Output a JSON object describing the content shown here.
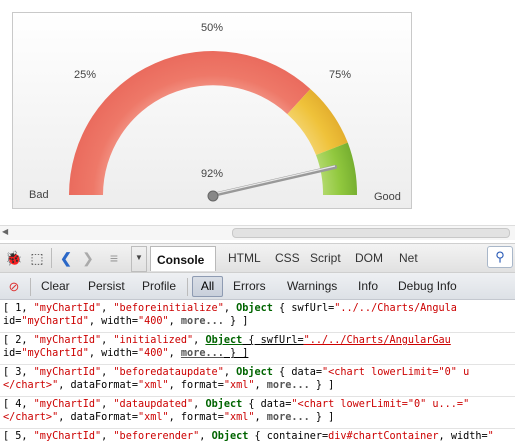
{
  "gauge": {
    "labels": {
      "bad": "Bad",
      "good": "Good",
      "p25": "25%",
      "p50": "50%",
      "p75": "75%",
      "value": "92%"
    },
    "value_percent": 92,
    "colors": {
      "red": "#ef7d6f",
      "yellow": "#f0c640",
      "green": "#8cc63f"
    }
  },
  "toolbar": {
    "console_tab": "Console",
    "panels": [
      "HTML",
      "CSS",
      "Script",
      "DOM",
      "Net"
    ]
  },
  "filterbar": {
    "clear": "Clear",
    "persist": "Persist",
    "profile": "Profile",
    "filters": [
      "All",
      "Errors",
      "Warnings",
      "Info",
      "Debug Info"
    ],
    "selected": "All"
  },
  "log": [
    {
      "l1": [
        "[ 1, ",
        "\"myChartId\"",
        ", ",
        "\"beforeinitialize\"",
        ", ",
        "Object",
        " { ",
        "swfUrl=",
        "\"../../Charts/Angula"
      ],
      "l2": [
        "id=",
        "\"myChartId\"",
        ",  ",
        "width=",
        "\"400\"",
        ",  ",
        "more...",
        " } ]"
      ]
    },
    {
      "l1": [
        "[ 2, ",
        "\"myChartId\"",
        ", ",
        "\"initialized\"",
        ", ",
        "Object",
        " { ",
        "swfUrl=",
        "\"../../Charts/AngularGau"
      ],
      "l2": [
        "id=",
        "\"myChartId\"",
        ",  ",
        "width=",
        "\"400\"",
        ",  ",
        "more...",
        " } ]"
      ]
    },
    {
      "l1": [
        "[ 3, ",
        "\"myChartId\"",
        ", ",
        "\"beforedataupdate\"",
        ", ",
        "Object",
        " { ",
        "data=",
        "\"<chart lowerLimit=\"0\" u"
      ],
      "l2": [
        "</chart>\"",
        ",  ",
        "dataFormat=",
        "\"xml\"",
        ",  ",
        "format=",
        "\"xml\"",
        ",  ",
        "more...",
        " } ]"
      ]
    },
    {
      "l1": [
        "[ 4, ",
        "\"myChartId\"",
        ", ",
        "\"dataupdated\"",
        ", ",
        "Object",
        " { ",
        "data=",
        "\"<chart lowerLimit=\"0\" u...=\""
      ],
      "l2": [
        "</chart>\"",
        ",  ",
        "dataFormat=",
        "\"xml\"",
        ",  ",
        "format=",
        "\"xml\"",
        ",  ",
        "more...",
        " } ]"
      ]
    },
    {
      "l1": [
        "[ 5, ",
        "\"myChartId\"",
        ", ",
        "\"beforerender\"",
        ", ",
        "Object",
        " { ",
        "container=",
        "div#chartContainer",
        ",  ",
        "width=",
        "\""
      ]
    }
  ]
}
